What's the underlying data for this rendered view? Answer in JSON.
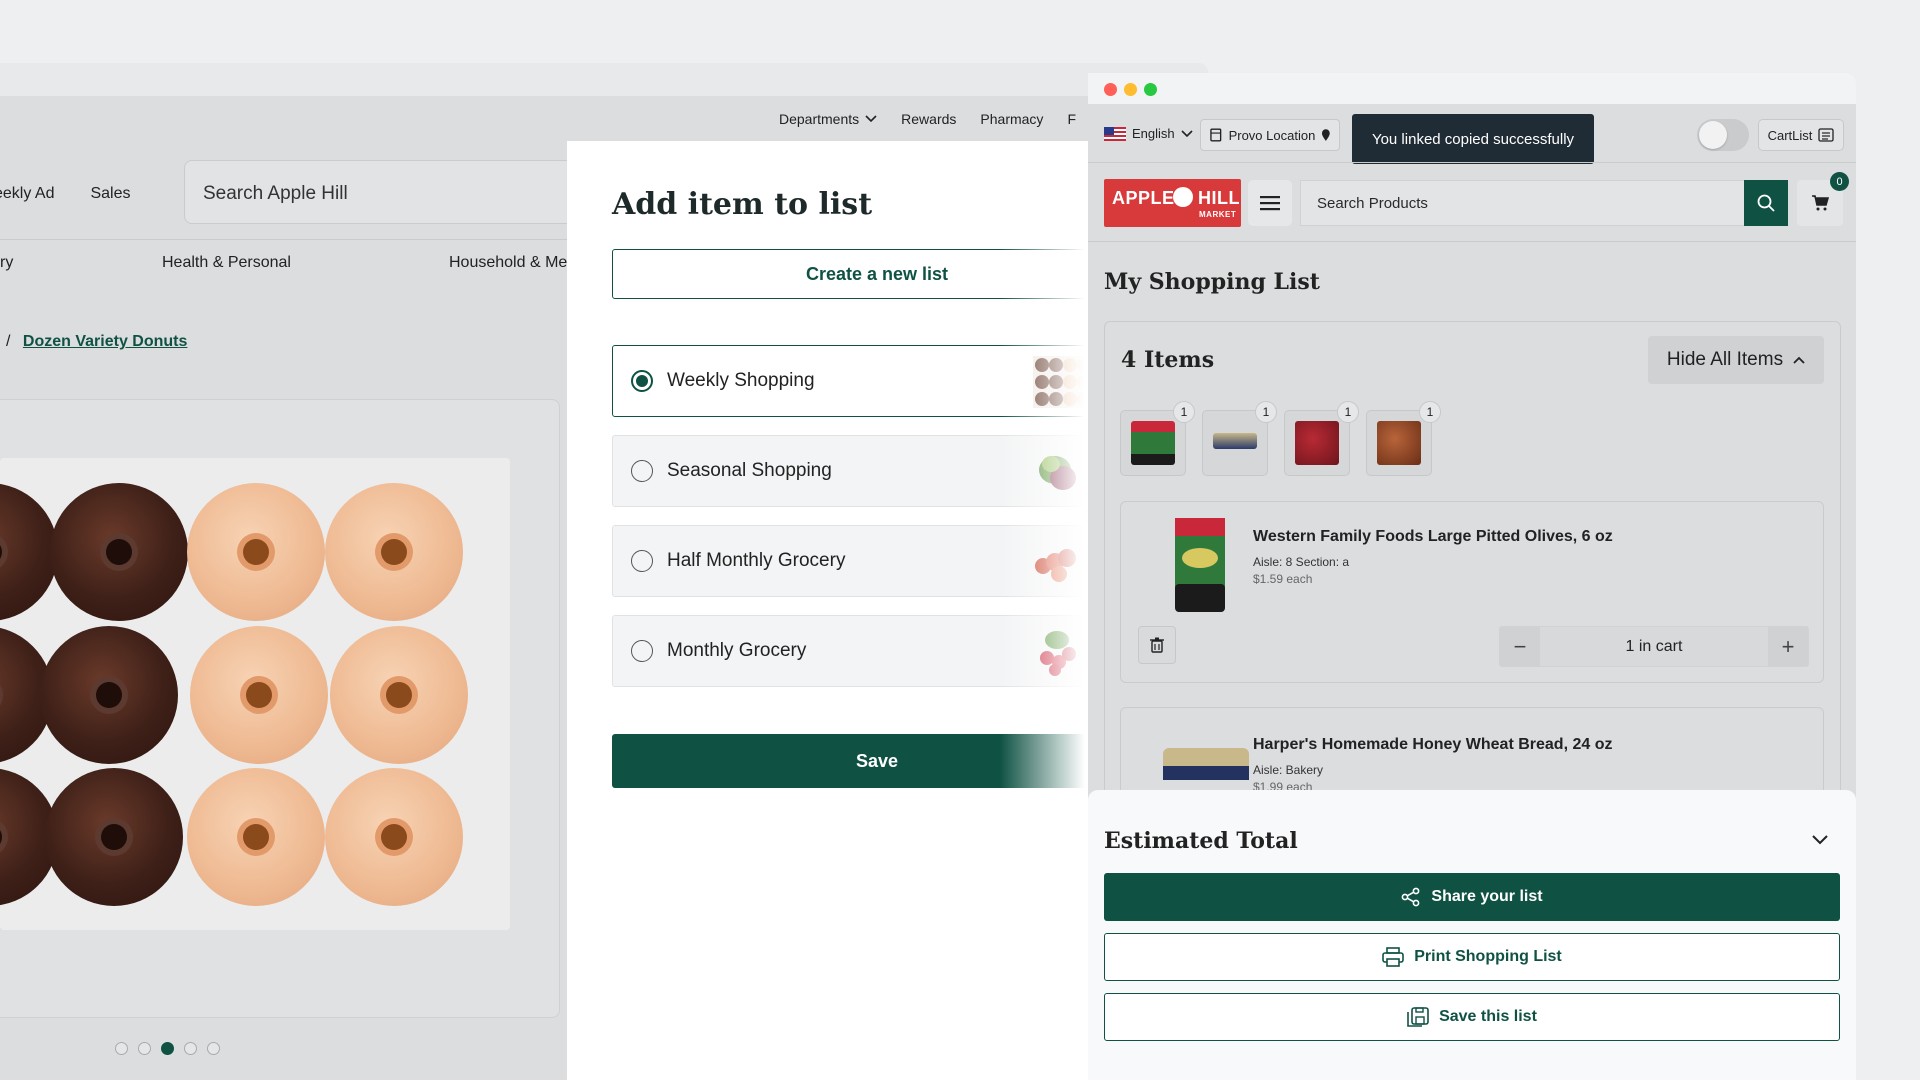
{
  "store": {
    "topnav": [
      "Departments",
      "Rewards",
      "Pharmacy",
      "F"
    ],
    "pillnav": [
      "eekly Ad",
      "Sales"
    ],
    "search_placeholder": "Search Apple Hill",
    "categories": [
      "ry",
      "Health & Personal",
      "Household & Me"
    ],
    "breadcrumb_sep": "/",
    "breadcrumb_current": "Dozen Variety Donuts",
    "carousel": {
      "count": 5,
      "active": 3
    }
  },
  "modal": {
    "title": "Add item to list",
    "create_label": "Create a new list",
    "lists": [
      {
        "name": "Weekly Shopping",
        "selected": true,
        "thumb": "donuts-icon"
      },
      {
        "name": "Seasonal Shopping",
        "selected": false,
        "thumb": "lettuce-icon"
      },
      {
        "name": "Half Monthly Grocery",
        "selected": false,
        "thumb": "onions-icon"
      },
      {
        "name": "Monthly Grocery",
        "selected": false,
        "thumb": "radishes-icon"
      }
    ],
    "save_label": "Save"
  },
  "cart": {
    "language": "English",
    "location": "Provo Location",
    "toast": "You linked copied successfully",
    "cartlist_label": "CartList",
    "logo_left": "APPLE",
    "logo_right": "HILL",
    "logo_sub": "MARKET",
    "search_placeholder": "Search Products",
    "cart_count": "0",
    "page_title": "My Shopping List",
    "items_count": "4 Items",
    "hide_all": "Hide All Items",
    "mini_items": [
      {
        "qty": "1",
        "color": "#2f7a3a"
      },
      {
        "qty": "1",
        "color": "#b8a878"
      },
      {
        "qty": "1",
        "color": "#8a1e24"
      },
      {
        "qty": "1",
        "color": "#9a4a2a"
      }
    ],
    "products": [
      {
        "name": "Western Family Foods Large Pitted Olives, 6 oz",
        "aisle": "Aisle: 8 Section: a",
        "price": "$1.59 each",
        "qty": "1 in cart"
      },
      {
        "name": "Harper's Homemade Honey Wheat Bread, 24 oz",
        "aisle": "Aisle: Bakery",
        "price": "$1.99 each"
      }
    ],
    "estimated_total": "Estimated Total",
    "share_label": "Share your list",
    "print_label": "Print Shopping List",
    "save_list_label": "Save this list"
  },
  "colors": {
    "brand_green": "#0f5244",
    "logo_red": "#d8393a",
    "toast_bg": "#1f2b35"
  }
}
